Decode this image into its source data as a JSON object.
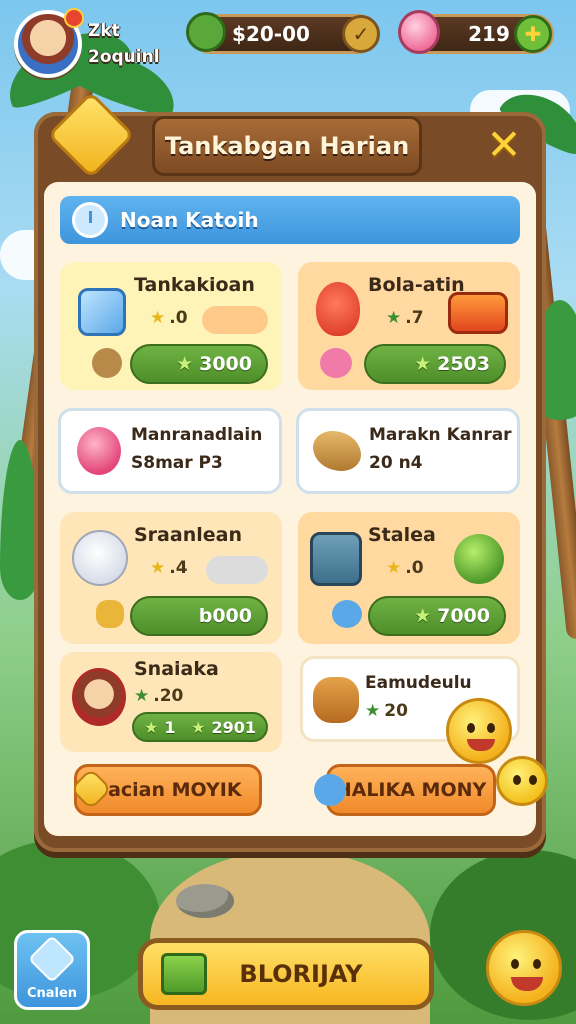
{
  "player": {
    "line1": "Zkt",
    "line2": "2oquinl"
  },
  "resources": {
    "coins": {
      "value": "$20-00",
      "icon": "leaf-icon"
    },
    "gems": {
      "value": "219",
      "icon": "heart-gem-icon"
    }
  },
  "panel": {
    "title": "Tankabgan Harian",
    "banner": "Noan Katoih"
  },
  "cards": [
    {
      "title": "Tankakioan",
      "stat": ".0",
      "reward": "3000",
      "icon": "ice-cube-icon"
    },
    {
      "title": "Bola-atin",
      "stat": ".7",
      "reward": "2503",
      "icon": "strawberry-icon"
    },
    {
      "title": "Manranadlain",
      "sub": "S8mar P3",
      "icon": "berry-icon"
    },
    {
      "title": "Marakn Kanrar",
      "sub": "20 n4",
      "icon": "fish-bone-icon"
    },
    {
      "title": "Sraanlean",
      "stat": ".4",
      "reward": "b000",
      "icon": "ghost-icon"
    },
    {
      "title": "Stalea",
      "stat": ".0",
      "reward": "7000",
      "icon": "robot-icon"
    },
    {
      "title": "Snaiaka",
      "stat": ".20",
      "reward_left": "1",
      "reward_right": "2901",
      "icon": "adventurer-icon"
    },
    {
      "title": "Eamudeulu",
      "stat": "20",
      "icon": "bread-icon"
    }
  ],
  "actions": {
    "left": "Sacian MOYIK",
    "right": "HALIKA MONY"
  },
  "bottom": {
    "corner_label": "Cnalen",
    "play_label": "BLORIJAY"
  },
  "colors": {
    "wood": "#7a4b27",
    "panel_bg": "#fdf3de",
    "banner": "#3e95dc",
    "reward_green": "#4e8f2a",
    "action_orange": "#f08a2a"
  }
}
